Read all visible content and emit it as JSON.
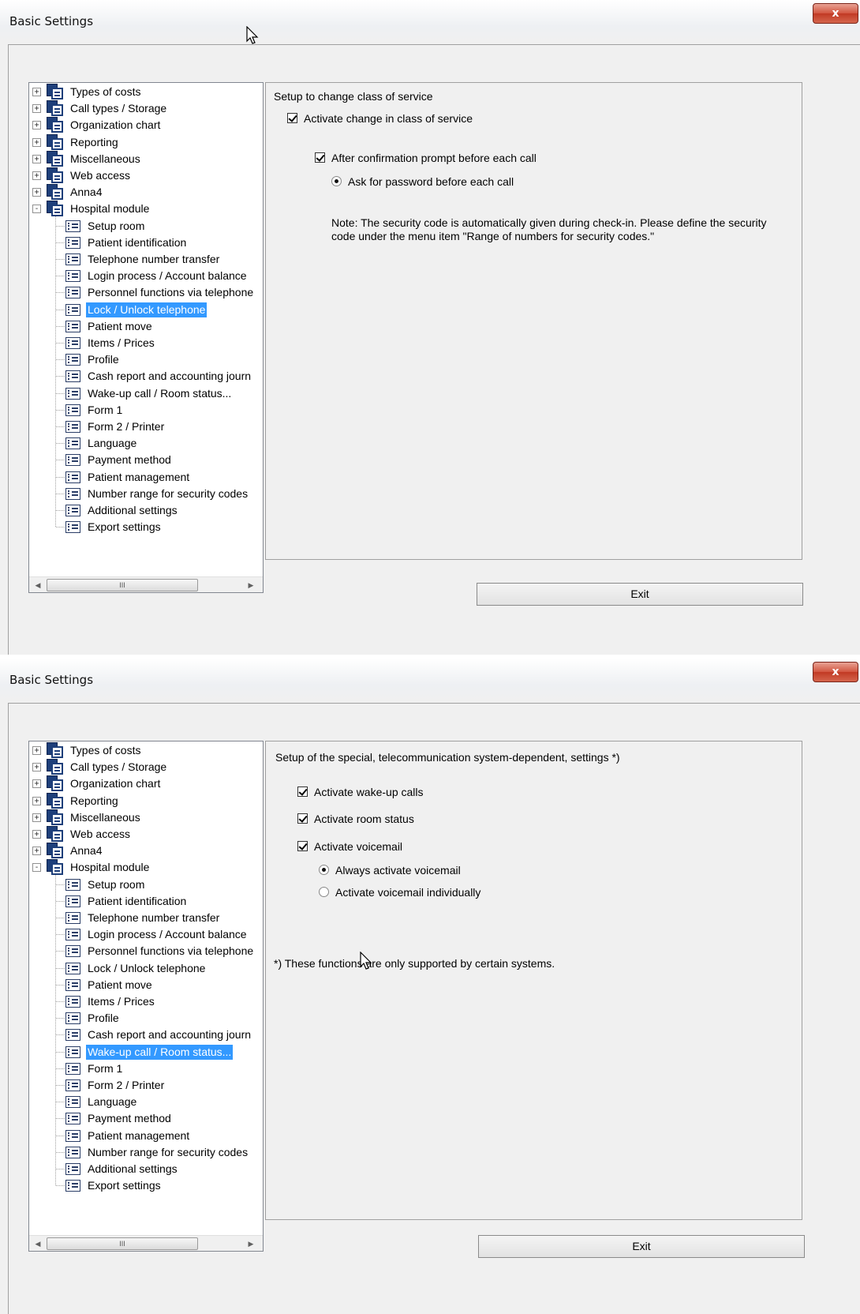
{
  "windows": [
    {
      "title": "Basic Settings",
      "close_label": "x",
      "tree": {
        "groups": [
          "Types of costs",
          "Call types / Storage",
          "Organization chart",
          "Reporting",
          "Miscellaneous",
          "Web access",
          "Anna4",
          "Hospital module"
        ],
        "group_expanders": [
          "+",
          "+",
          "+",
          "+",
          "+",
          "+",
          "+",
          "-"
        ],
        "children": [
          "Setup room",
          "Patient identification",
          "Telephone number transfer",
          "Login process / Account balance",
          "Personnel functions via telephone",
          "Lock / Unlock telephone",
          "Patient move",
          "Items / Prices",
          "Profile",
          "Cash report and accounting journ",
          "Wake-up call / Room status...",
          "Form 1",
          "Form 2 / Printer",
          "Language",
          "Payment method",
          "Patient management",
          "Number range for security codes",
          "Additional settings",
          "Export settings"
        ],
        "selected": "Lock / Unlock telephone",
        "scroll_thumb_label": "III",
        "scroll_left": "◀",
        "scroll_right": "▶"
      },
      "panel": {
        "heading": "Setup to change class of service",
        "activate_change_label": "Activate change in class of service",
        "activate_change_checked": true,
        "confirmation_label": "After confirmation prompt before each call",
        "confirmation_checked": true,
        "password_label": "Ask for password before each call",
        "password_selected": true,
        "note": "Note: The security code is automatically given during check-in. Please define the security code under the menu item \"Range of numbers for security codes.\""
      },
      "exit_label": "Exit"
    },
    {
      "title": "Basic Settings",
      "close_label": "x",
      "tree": {
        "groups": [
          "Types of costs",
          "Call types / Storage",
          "Organization chart",
          "Reporting",
          "Miscellaneous",
          "Web access",
          "Anna4",
          "Hospital module"
        ],
        "group_expanders": [
          "+",
          "+",
          "+",
          "+",
          "+",
          "+",
          "+",
          "-"
        ],
        "children": [
          "Setup room",
          "Patient identification",
          "Telephone number transfer",
          "Login process / Account balance",
          "Personnel functions via telephone",
          "Lock / Unlock telephone",
          "Patient move",
          "Items / Prices",
          "Profile",
          "Cash report and accounting journ",
          "Wake-up call / Room status...",
          "Form 1",
          "Form 2 / Printer",
          "Language",
          "Payment method",
          "Patient management",
          "Number range for security codes",
          "Additional settings",
          "Export settings"
        ],
        "selected": "Wake-up call / Room status...",
        "scroll_thumb_label": "III",
        "scroll_left": "◀",
        "scroll_right": "▶"
      },
      "panel": {
        "heading": "Setup of the special, telecommunication system-dependent, settings *)",
        "wakeup_label": "Activate wake-up calls",
        "wakeup_checked": true,
        "room_status_label": "Activate room status",
        "room_status_checked": true,
        "voicemail_label": "Activate voicemail",
        "voicemail_checked": true,
        "always_voicemail_label": "Always activate voicemail",
        "always_voicemail_selected": true,
        "individual_voicemail_label": "Activate voicemail individually",
        "individual_voicemail_selected": false,
        "footnote": "*) These functions are only supported by certain systems."
      },
      "exit_label": "Exit"
    }
  ]
}
